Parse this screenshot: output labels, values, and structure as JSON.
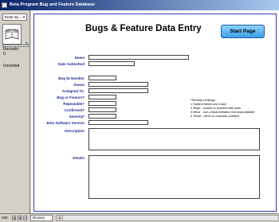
{
  "window": {
    "title": "Beta Program Bug and Feature Database"
  },
  "status_area": {
    "layout_menu": "Enter Bu...",
    "page_number": "0",
    "records_label": "Records:",
    "records_value": "0",
    "sort_status": "Unsorted"
  },
  "bottom_bar": {
    "zoom": "100",
    "mode": "Browse"
  },
  "form": {
    "title": "Bugs & Feature Data Entry",
    "start_button": "Start Page",
    "labels": {
      "name": "Name",
      "date_submitted": "Date Submitted",
      "bug_id": "Bug ID Number",
      "status": "Status",
      "assigned_to": "Assigned To:",
      "bug_or_feature": "Bug or Feature?",
      "repeatable": "Repeatable?",
      "confirmed": "Confirmed?",
      "severity": "Severity*",
      "beta_version": "Beta Software Version",
      "description": "Description",
      "details": "Details"
    },
    "severity_note": [
      "*Severity rankings-",
      "1 System failure and crash",
      "2 Major - unable to proceed with work",
      "3 Minor - non-critical limitation but unacceptable",
      "4 Trivial - minor or cosmetic problem"
    ]
  }
}
